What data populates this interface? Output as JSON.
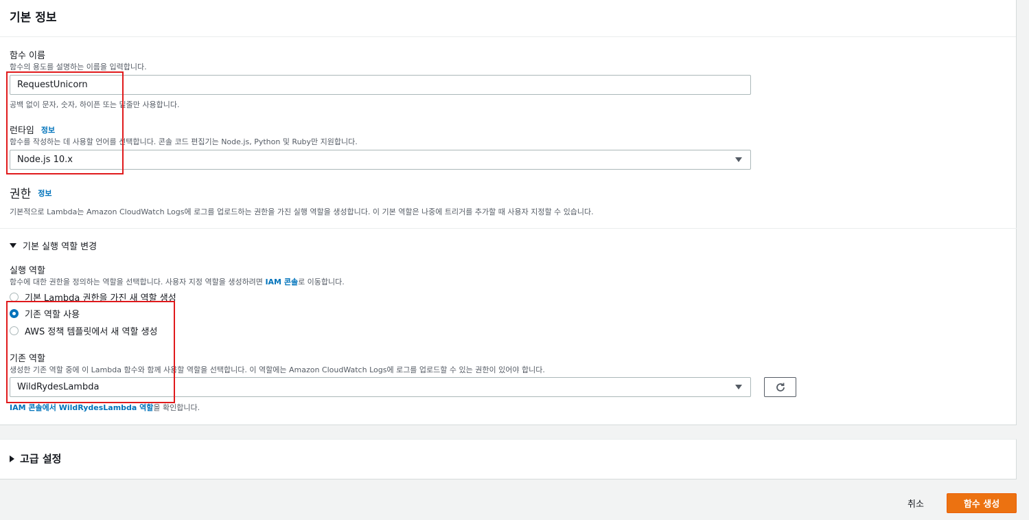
{
  "basic_info": {
    "title": "기본 정보",
    "function_name": {
      "label": "함수 이름",
      "description": "함수의 용도를 설명하는 이름을 입력합니다.",
      "value": "RequestUnicorn",
      "hint": "공백 없이 문자, 숫자, 하이픈 또는 밑줄만 사용합니다."
    },
    "runtime": {
      "label": "런타임",
      "info_link": "정보",
      "description": "함수를 작성하는 데 사용할 언어를 선택합니다. 콘솔 코드 편집기는 Node.js, Python 및 Ruby만 지원합니다.",
      "selected": "Node.js 10.x"
    }
  },
  "permissions": {
    "title": "권한",
    "info_link": "정보",
    "description": "기본적으로 Lambda는 Amazon CloudWatch Logs에 로그를 업로드하는 권한을 가진 실행 역할을 생성합니다. 이 기본 역할은 나중에 트리거를 추가할 때 사용자 지정할 수 있습니다.",
    "change_role_toggle": "기본 실행 역할 변경",
    "execution_role": {
      "label": "실행 역할",
      "description": "함수에 대한 권한을 정의하는 역할을 선택합니다. 사용자 지정 역할을 생성하려면",
      "iam_console_link": "IAM 콘솔",
      "description_suffix": "로 이동합니다.",
      "options": [
        {
          "label": "기본 Lambda 권한을 가진 새 역할 생성",
          "checked": false
        },
        {
          "label": "기존 역할 사용",
          "checked": true
        },
        {
          "label": "AWS 정책 템플릿에서 새 역할 생성",
          "checked": false
        }
      ]
    },
    "existing_role": {
      "label": "기존 역할",
      "description": "생성한 기존 역할 중에 이 Lambda 함수와 함께 사용할 역할을 선택합니다. 이 역할에는 Amazon CloudWatch Logs에 로그를 업로드할 수 있는 권한이 있어야 합니다.",
      "selected": "WildRydesLambda",
      "view_link": "IAM 콘솔에서 WildRydesLambda 역할",
      "view_suffix": "을 확인합니다."
    }
  },
  "advanced": {
    "title": "고급 설정"
  },
  "footer": {
    "cancel": "취소",
    "create": "함수 생성"
  },
  "colors": {
    "accent": "#0073bb",
    "primary_button": "#ec7211",
    "highlight_box": "#e0191b"
  }
}
